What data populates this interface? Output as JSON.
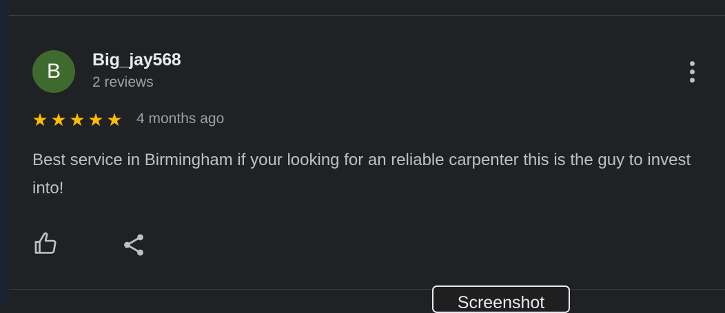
{
  "review": {
    "avatar_initial": "B",
    "avatar_color": "#3e6b2d",
    "reviewer_name": "Big_jay568",
    "review_count": "2 reviews",
    "rating": 5,
    "rating_max": 5,
    "star_glyph": "★",
    "star_color": "#fbbc04",
    "time_ago": "4 months ago",
    "text": "Best service in Birmingham if your looking for an reliable carpenter this is the guy to invest into!"
  },
  "actions": {
    "like_icon": "thumbs-up-icon",
    "share_icon": "share-icon",
    "more_icon": "more-vert-icon"
  },
  "overlay": {
    "screenshot_label": "Screenshot"
  }
}
